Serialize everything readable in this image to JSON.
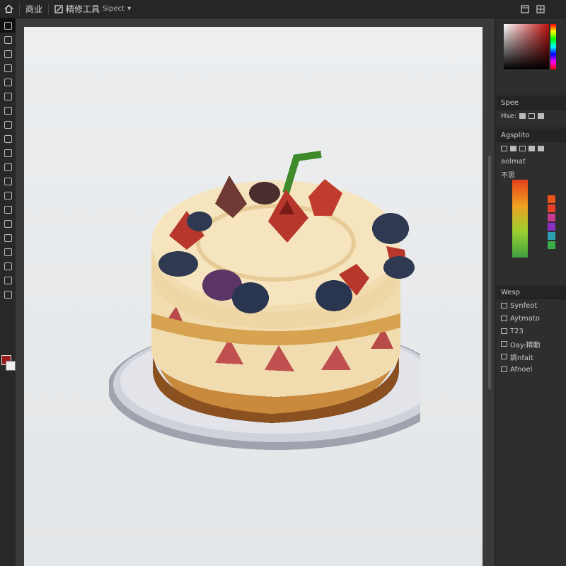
{
  "topbar": {
    "home_icon": "home-icon",
    "menu_label": "商业",
    "tool_label": "精修工具",
    "dropdown_label": "Sipect",
    "right_icons": [
      "window-icon",
      "grid-icon"
    ]
  },
  "tools": [
    "move-icon",
    "lasso-icon",
    "marquee-icon",
    "crop-icon",
    "eyedropper-icon",
    "brush-icon",
    "stamp-icon",
    "eraser-icon",
    "gradient-icon",
    "pen-icon",
    "text-icon",
    "shape-icon",
    "hand-icon",
    "zoom-icon",
    "dodge-icon",
    "blur-icon",
    "path-icon",
    "note-icon",
    "mask-icon",
    "screen-icon"
  ],
  "colors": {
    "foreground": "#9b1d1d",
    "background": "#eeeeee"
  },
  "panels": {
    "swatch_head": "Spee",
    "swatch_row_label": "Hse:",
    "adjust_head": "Agsplito",
    "adjust_row1": "aolmat",
    "adjust_row2": "不思",
    "layers_head": "Wesp",
    "layer_items": [
      "Synfeot",
      "Aytmato",
      "T23",
      "Oay:精動",
      "調nfait",
      "Afnoel"
    ]
  },
  "palette_colors": [
    "#e8541c",
    "#e6402a",
    "#c53a8e",
    "#8a2fc6",
    "#2d9fb0",
    "#3aae4a"
  ],
  "artwork": {
    "subject": "pixel-cake"
  }
}
